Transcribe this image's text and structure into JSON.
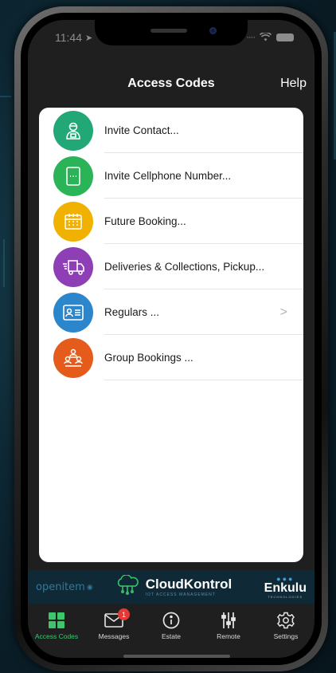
{
  "status_bar": {
    "time": "11:44",
    "location_arrow": "location-arrow-icon"
  },
  "nav": {
    "title": "Access Codes",
    "help": "Help"
  },
  "list": [
    {
      "label": "Invite Contact...",
      "color": "#22a876",
      "icon": "person-icon",
      "chevron": false
    },
    {
      "label": "Invite Cellphone Number...",
      "color": "#2bb358",
      "icon": "cellphone-icon",
      "chevron": false
    },
    {
      "label": "Future Booking...",
      "color": "#f0b100",
      "icon": "calendar-icon",
      "chevron": false
    },
    {
      "label": "Deliveries & Collections, Pickup...",
      "color": "#8e3fb5",
      "icon": "truck-icon",
      "chevron": false
    },
    {
      "label": "Regulars ...",
      "color": "#2b86cc",
      "icon": "id-card-icon",
      "chevron": true
    },
    {
      "label": "Group Bookings ...",
      "color": "#e45b1c",
      "icon": "group-icon",
      "chevron": false
    }
  ],
  "brands": {
    "openitem": "openitem",
    "cloudkontrol": "CloudKontrol",
    "cloudkontrol_sub": "IOT ACCESS MANAGEMENT",
    "enkulu": "Enkulu",
    "enkulu_sub": "TECHNOLOGIES"
  },
  "tabs": [
    {
      "label": "Access Codes",
      "icon": "grid-icon",
      "active": true
    },
    {
      "label": "Messages",
      "icon": "envelope-icon",
      "badge": "1"
    },
    {
      "label": "Estate",
      "icon": "info-icon"
    },
    {
      "label": "Remote",
      "icon": "sliders-icon"
    },
    {
      "label": "Settings",
      "icon": "gear-icon"
    }
  ],
  "colors": {
    "active_tab": "#3cc76d",
    "badge": "#e53935",
    "nav_bg": "#1f1f1f"
  }
}
